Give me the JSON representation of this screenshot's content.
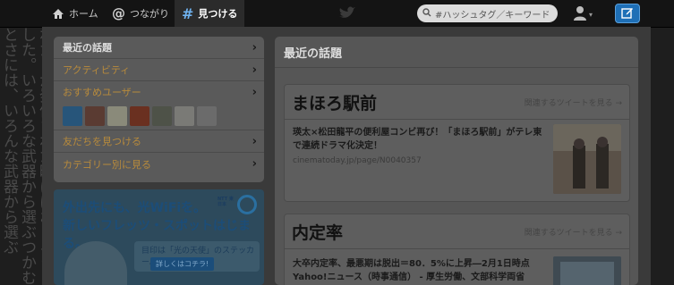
{
  "background_text": "わたしが発信された時にはおどろきました。いろいろな武器から選ぶつかむとさには、いろんな武器から選ぶ",
  "topbar": {
    "home_label": "ホーム",
    "connect_label": "つながり",
    "discover_label": "見つける",
    "search_placeholder": "#ハッシュタグ／キーワード"
  },
  "sidebar": {
    "items": [
      {
        "label": "最近の話題"
      },
      {
        "label": "アクティビティ"
      },
      {
        "label": "おすすめユーザー"
      },
      {
        "label": "友だちを見つける"
      },
      {
        "label": "カテゴリー別に見る"
      }
    ]
  },
  "ad": {
    "line1": "外出先にも、光WiFiを。",
    "line2": "新しいフレッツ・スポットはじまる。",
    "sub": "目印は「光の天使」のステッカー。",
    "button": "詳しくはコチラ!",
    "brand": "NTT 東日本"
  },
  "main": {
    "title": "最近の話題",
    "cards": [
      {
        "topic": "まほろ駅前",
        "more": "関連するツイートを見る →",
        "tweet": "瑛太×松田龍平の便利屋コンビ再び！「まほろ駅前」がテレ東で連続ドラマ化決定！",
        "url": "cinematoday.jp/page/N0040357"
      },
      {
        "topic": "内定率",
        "more": "関連するツイートを見る →",
        "tweet": "大卒内定率、最悪期は脱出＝80．5%に上昇―2月1日時点 Yahoo!ニュース（時事通信） - 厚生労働、文部科学両省"
      }
    ]
  },
  "colors": {
    "accent": "#1e6fb6",
    "link": "#b78a3c"
  }
}
